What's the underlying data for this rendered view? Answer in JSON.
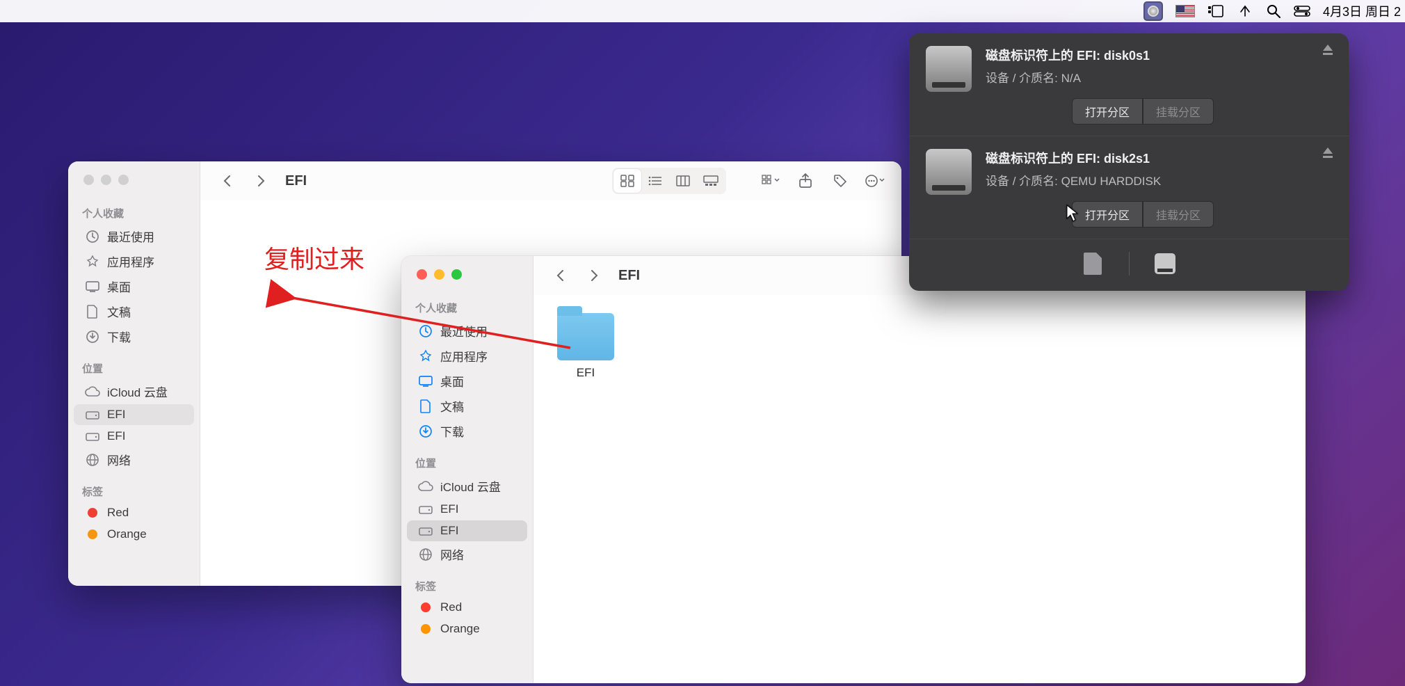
{
  "menubar": {
    "date_text": "4月3日 周日 2"
  },
  "annotation": {
    "copy_text": "复制过来"
  },
  "sidebar_labels": {
    "favorites": "个人收藏",
    "recents": "最近使用",
    "applications": "应用程序",
    "desktop": "桌面",
    "documents": "文稿",
    "downloads": "下载",
    "locations": "位置",
    "icloud": "iCloud 云盘",
    "efi": "EFI",
    "network": "网络",
    "tags": "标签",
    "red": "Red",
    "orange": "Orange"
  },
  "finder1": {
    "title": "EFI"
  },
  "finder2": {
    "title": "EFI",
    "item1": "EFI"
  },
  "popover": {
    "entries": [
      {
        "title": "磁盘标识符上的 EFI: disk0s1",
        "sub": "设备 / 介质名: N/A",
        "btn_open": "打开分区",
        "btn_mount": "挂载分区"
      },
      {
        "title": "磁盘标识符上的 EFI: disk2s1",
        "sub": "设备 / 介质名: QEMU HARDDISK",
        "btn_open": "打开分区",
        "btn_mount": "挂载分区"
      }
    ]
  }
}
